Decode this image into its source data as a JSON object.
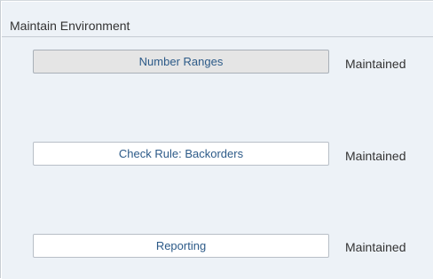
{
  "section": {
    "title": "Maintain Environment"
  },
  "rows": [
    {
      "button_label": "Number Ranges",
      "status": "Maintained"
    },
    {
      "button_label": "Check Rule: Backorders",
      "status": "Maintained"
    },
    {
      "button_label": "Reporting",
      "status": "Maintained"
    }
  ],
  "colors": {
    "panel_background": "#edf2f7",
    "button_text": "#2c5a88",
    "active_button_background": "#e5e5e5"
  }
}
